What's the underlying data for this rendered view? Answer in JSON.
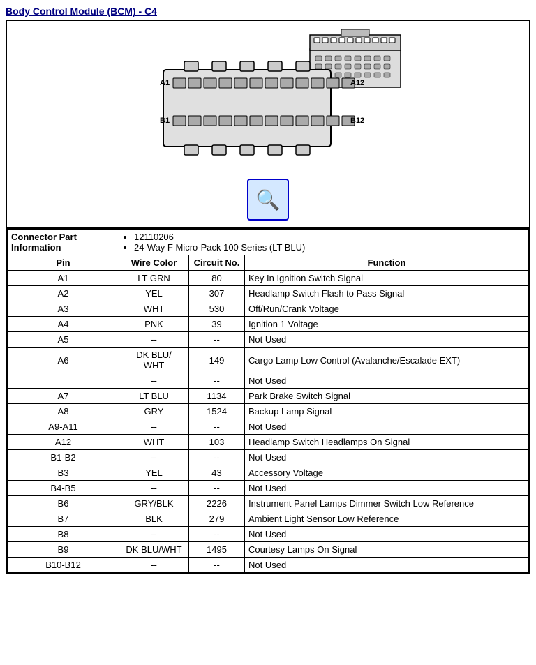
{
  "page": {
    "title": "Body Control Module (BCM) - C4"
  },
  "connector": {
    "info_label": "Connector Part Information",
    "part_number": "12110206",
    "description": "24-Way F Micro-Pack 100 Series (LT BLU)"
  },
  "table": {
    "headers": {
      "pin": "Pin",
      "wire_color": "Wire Color",
      "circuit_no": "Circuit No.",
      "function": "Function"
    },
    "rows": [
      {
        "pin": "A1",
        "wire_color": "LT GRN",
        "circuit_no": "80",
        "function": "Key In Ignition Switch Signal"
      },
      {
        "pin": "A2",
        "wire_color": "YEL",
        "circuit_no": "307",
        "function": "Headlamp Switch Flash to Pass Signal"
      },
      {
        "pin": "A3",
        "wire_color": "WHT",
        "circuit_no": "530",
        "function": "Off/Run/Crank Voltage"
      },
      {
        "pin": "A4",
        "wire_color": "PNK",
        "circuit_no": "39",
        "function": "Ignition 1 Voltage"
      },
      {
        "pin": "A5",
        "wire_color": "--",
        "circuit_no": "--",
        "function": "Not Used"
      },
      {
        "pin": "A6",
        "wire_color": "DK BLU/\nWHT",
        "circuit_no": "149",
        "function": "Cargo Lamp Low Control (Avalanche/Escalade EXT)"
      },
      {
        "pin": "",
        "wire_color": "--",
        "circuit_no": "--",
        "function": "Not Used"
      },
      {
        "pin": "A7",
        "wire_color": "LT BLU",
        "circuit_no": "1134",
        "function": "Park Brake Switch Signal"
      },
      {
        "pin": "A8",
        "wire_color": "GRY",
        "circuit_no": "1524",
        "function": "Backup Lamp Signal"
      },
      {
        "pin": "A9-A11",
        "wire_color": "--",
        "circuit_no": "--",
        "function": "Not Used"
      },
      {
        "pin": "A12",
        "wire_color": "WHT",
        "circuit_no": "103",
        "function": "Headlamp Switch Headlamps On Signal"
      },
      {
        "pin": "B1-B2",
        "wire_color": "--",
        "circuit_no": "--",
        "function": "Not Used"
      },
      {
        "pin": "B3",
        "wire_color": "YEL",
        "circuit_no": "43",
        "function": "Accessory Voltage"
      },
      {
        "pin": "B4-B5",
        "wire_color": "--",
        "circuit_no": "--",
        "function": "Not Used"
      },
      {
        "pin": "B6",
        "wire_color": "GRY/BLK",
        "circuit_no": "2226",
        "function": "Instrument Panel Lamps Dimmer Switch Low Reference"
      },
      {
        "pin": "B7",
        "wire_color": "BLK",
        "circuit_no": "279",
        "function": "Ambient Light Sensor Low Reference"
      },
      {
        "pin": "B8",
        "wire_color": "--",
        "circuit_no": "--",
        "function": "Not Used"
      },
      {
        "pin": "B9",
        "wire_color": "DK BLU/WHT",
        "circuit_no": "1495",
        "function": "Courtesy Lamps On Signal"
      },
      {
        "pin": "B10-B12",
        "wire_color": "--",
        "circuit_no": "--",
        "function": "Not Used"
      }
    ]
  }
}
